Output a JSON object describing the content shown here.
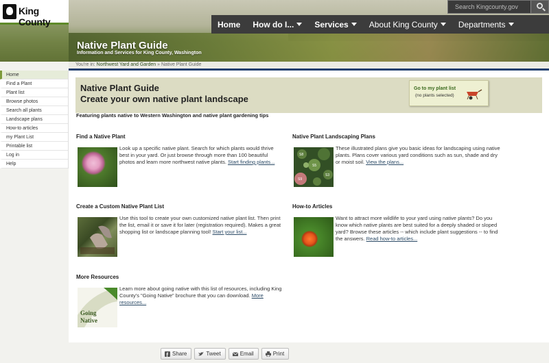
{
  "logo": {
    "text": "King County"
  },
  "search": {
    "placeholder": "Search Kingcounty.gov"
  },
  "topnav": {
    "items": [
      {
        "label": "Home"
      },
      {
        "label": "How do I..."
      },
      {
        "label": "Services"
      },
      {
        "label": "About King County"
      },
      {
        "label": "Departments"
      }
    ]
  },
  "site": {
    "title": "Native Plant Guide",
    "subtitle": "Information and Services for King County, Washington"
  },
  "breadcrumb": {
    "prefix": "You're in:",
    "link": "Northwest Yard and Garden",
    "separator": "»",
    "current": "Native Plant Guide"
  },
  "sidebar": {
    "items": [
      {
        "label": "Home"
      },
      {
        "label": "Find a Plant"
      },
      {
        "label": "Plant list"
      },
      {
        "label": "Browse photos"
      },
      {
        "label": "Search all plants"
      },
      {
        "label": "Landscape plans"
      },
      {
        "label": "How-to articles"
      },
      {
        "label": "my Plant List"
      },
      {
        "label": "Printable list"
      },
      {
        "label": "Log in"
      },
      {
        "label": "Help"
      }
    ]
  },
  "banner": {
    "title": "Native Plant Guide",
    "subtitle": "Create your own native plant landscape"
  },
  "plant_list_button": {
    "label": "Go to my plant list",
    "status": "(no plants selected)"
  },
  "tagline": "Featuring plants native to Western Washington and native plant gardening tips",
  "sections": {
    "find": {
      "heading": "Find a Native Plant",
      "text": "Look up a specific native plant. Search for which plants would thrive best in your yard. Or just browse through more than 100 beautiful photos and learn more northwest native plants. ",
      "link": "Start finding plants..."
    },
    "plans": {
      "heading": "Native Plant Landscaping Plans",
      "text": "These illustrated plans give you basic ideas for landscaping using native plants. Plans cover various yard conditions such as sun, shade and dry or moist soil. ",
      "link": "View the plans..."
    },
    "custom": {
      "heading": "Create a Custom Native Plant List",
      "text": "Use this tool to create your own customized native plant list. Then print the list, email it or save it for later (registration required). Makes a great shopping list or landscape planning tool! ",
      "link": "Start your list..."
    },
    "howto": {
      "heading": "How-to Articles",
      "text": "Want to attract more wildlife to your yard using native plants? Do you know which native plants are best suited for a deeply shaded or sloped yard? Browse these articles -- which include plant suggestions -- to find the answers. ",
      "link": "Read how-to articles..."
    },
    "resources": {
      "heading": "More Resources",
      "text": "Learn more about going native with this list of resources, including King County's \"Going Native\" brochure that you can download. ",
      "link": "More resources...",
      "thumb_text": "Going Native"
    }
  },
  "map_labels": [
    "S8",
    "S5",
    "S3",
    "S9"
  ],
  "share": {
    "items": [
      {
        "label": "Share",
        "icon": "facebook-icon"
      },
      {
        "label": "Tweet",
        "icon": "twitter-icon"
      },
      {
        "label": "Email",
        "icon": "email-icon"
      },
      {
        "label": "Print",
        "icon": "print-icon"
      }
    ]
  }
}
